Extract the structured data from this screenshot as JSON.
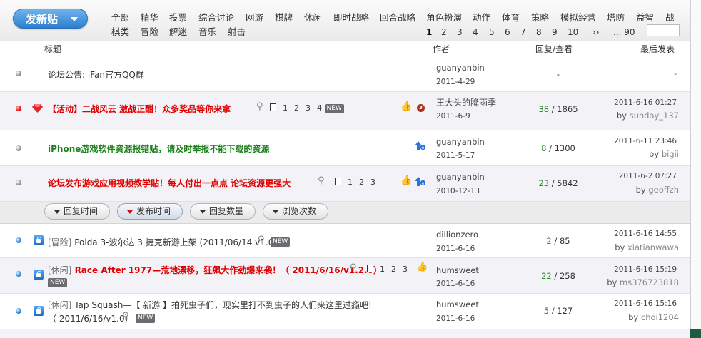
{
  "toolbar": {
    "new_post_label": "发新贴"
  },
  "categories": [
    "全部",
    "精华",
    "投票",
    "综合讨论",
    "网游",
    "棋牌",
    "休闲",
    "即时战略",
    "回合战略",
    "角色扮演",
    "动作",
    "体育",
    "策略",
    "模拟经营",
    "塔防",
    "益智",
    "战",
    "棋类",
    "冒险",
    "解迷",
    "音乐",
    "射击"
  ],
  "pager": {
    "pages": [
      "1",
      "2",
      "3",
      "4",
      "5",
      "6",
      "7",
      "8",
      "9",
      "10"
    ],
    "next": "››",
    "last": "... 90",
    "current": "1"
  },
  "table_header": {
    "title": "标题",
    "author": "作者",
    "replies_views": "回复/查看",
    "last_post": "最后发表"
  },
  "sort_buttons": [
    "回复时间",
    "发布时间",
    "回复数量",
    "浏览次数"
  ],
  "pinned_threads": [
    {
      "title": "论坛公告: iFan官方QQ群",
      "author": "guanyanbin",
      "date": "2011-4-29",
      "replies": "-",
      "views": "",
      "last_date": "-",
      "last_by": ""
    },
    {
      "title": "【活动】二战风云  激战正酣！众多奖品等你来拿",
      "author": "王大头的降雨季",
      "date": "2011-6-9",
      "replies": "38",
      "views": "1865",
      "last_date": "2011-6-16 01:27",
      "last_by": "sunday_137",
      "pages": [
        "1",
        "2",
        "3",
        "4"
      ],
      "new_tag": "NEW"
    },
    {
      "title": "iPhone游戏软件资源报错贴，请及时举报不能下载的资源",
      "author": "guanyanbin",
      "date": "2011-5-17",
      "replies": "8",
      "views": "1300",
      "last_date": "2011-6-11 23:46",
      "last_by": "bigii"
    },
    {
      "title": "论坛发布游戏应用视频教学贴！每人付出一点点  论坛资源更强大",
      "author": "guanyanbin",
      "date": "2010-12-13",
      "replies": "23",
      "views": "5842",
      "last_date": "2011-6-2 07:27",
      "last_by": "geoffzh",
      "pages": [
        "1",
        "2",
        "3"
      ]
    }
  ],
  "threads": [
    {
      "prefix": "[冒险]",
      "title": "Polda 3-波尔达 3 捷克新游上架 (2011/06/14 v1.0)",
      "new_tag": "NEW",
      "author": "dillionzero",
      "date": "2011-6-16",
      "replies": "2",
      "views": "85",
      "last_date": "2011-6-16 14:55",
      "last_by": "xiatianwawa"
    },
    {
      "prefix": "[休闲]",
      "title": "Race After 1977—荒地漂移，狂飙大作劲爆来袭！（ 2011/6/16/v1.2.0）",
      "new_tag": "NEW",
      "pages": [
        "1",
        "2",
        "3"
      ],
      "author": "humsweet",
      "date": "2011-6-16",
      "replies": "22",
      "views": "258",
      "last_date": "2011-6-16 15:19",
      "last_by": "ms376723818"
    },
    {
      "prefix": "[休闲]",
      "title": "Tap Squash—【 新游 】拍死虫子们，现实里打不到虫子的人们来这里过瘾吧!",
      "title2": "（ 2011/6/16/v1.0）",
      "new_tag": "NEW",
      "author": "humsweet",
      "date": "2011-6-16",
      "replies": "5",
      "views": "127",
      "last_date": "2011-6-16 15:16",
      "last_by": "choi1204"
    }
  ],
  "colors": {
    "accent_blue": "#2d7fcf",
    "title_red": "#e00000",
    "title_green": "#1a7f1a",
    "reply_green": "#2a8a2a"
  },
  "icons": [
    "arrow-down-icon",
    "gem-icon",
    "attachment-icon",
    "document-icon",
    "thumbs-up-icon",
    "hot-icon",
    "up-arrow-icon",
    "lock-icon",
    "status-dot-icon"
  ]
}
